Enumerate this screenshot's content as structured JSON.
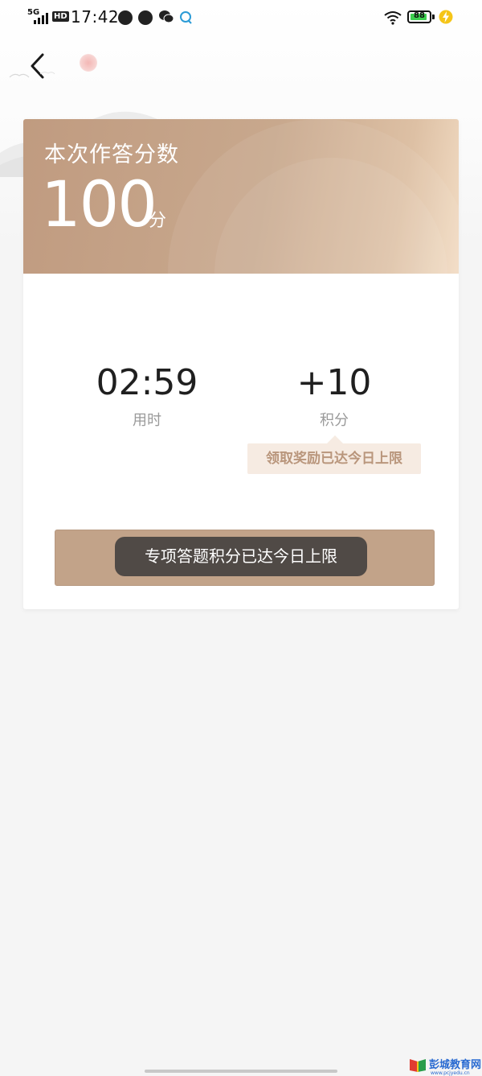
{
  "status_bar": {
    "network": "5G",
    "hd": "HD",
    "time": "17:42",
    "battery": "88",
    "battery_level_fraction": 0.88
  },
  "header": {
    "back_icon": "chevron-left-icon"
  },
  "result": {
    "score_label": "本次作答分数",
    "score_value": "100",
    "score_unit": "分"
  },
  "stats": {
    "time_value": "02:59",
    "time_label": "用时",
    "points_value": "+10",
    "points_label": "积分"
  },
  "tooltip": {
    "text": "领取奖励已达今日上限"
  },
  "toast": {
    "text": "专项答题积分已达今日上限"
  },
  "watermark": {
    "name": "彭城教育网",
    "url": "www.pcjyedu.cn"
  },
  "colors": {
    "header_gradient_start": "#c09b80",
    "header_gradient_end": "#f2dcc4",
    "action_bar": "#c2a389",
    "tooltip_bg": "#f6ebe2",
    "tooltip_text": "#b9967c",
    "page_bg": "#f5f5f5"
  }
}
